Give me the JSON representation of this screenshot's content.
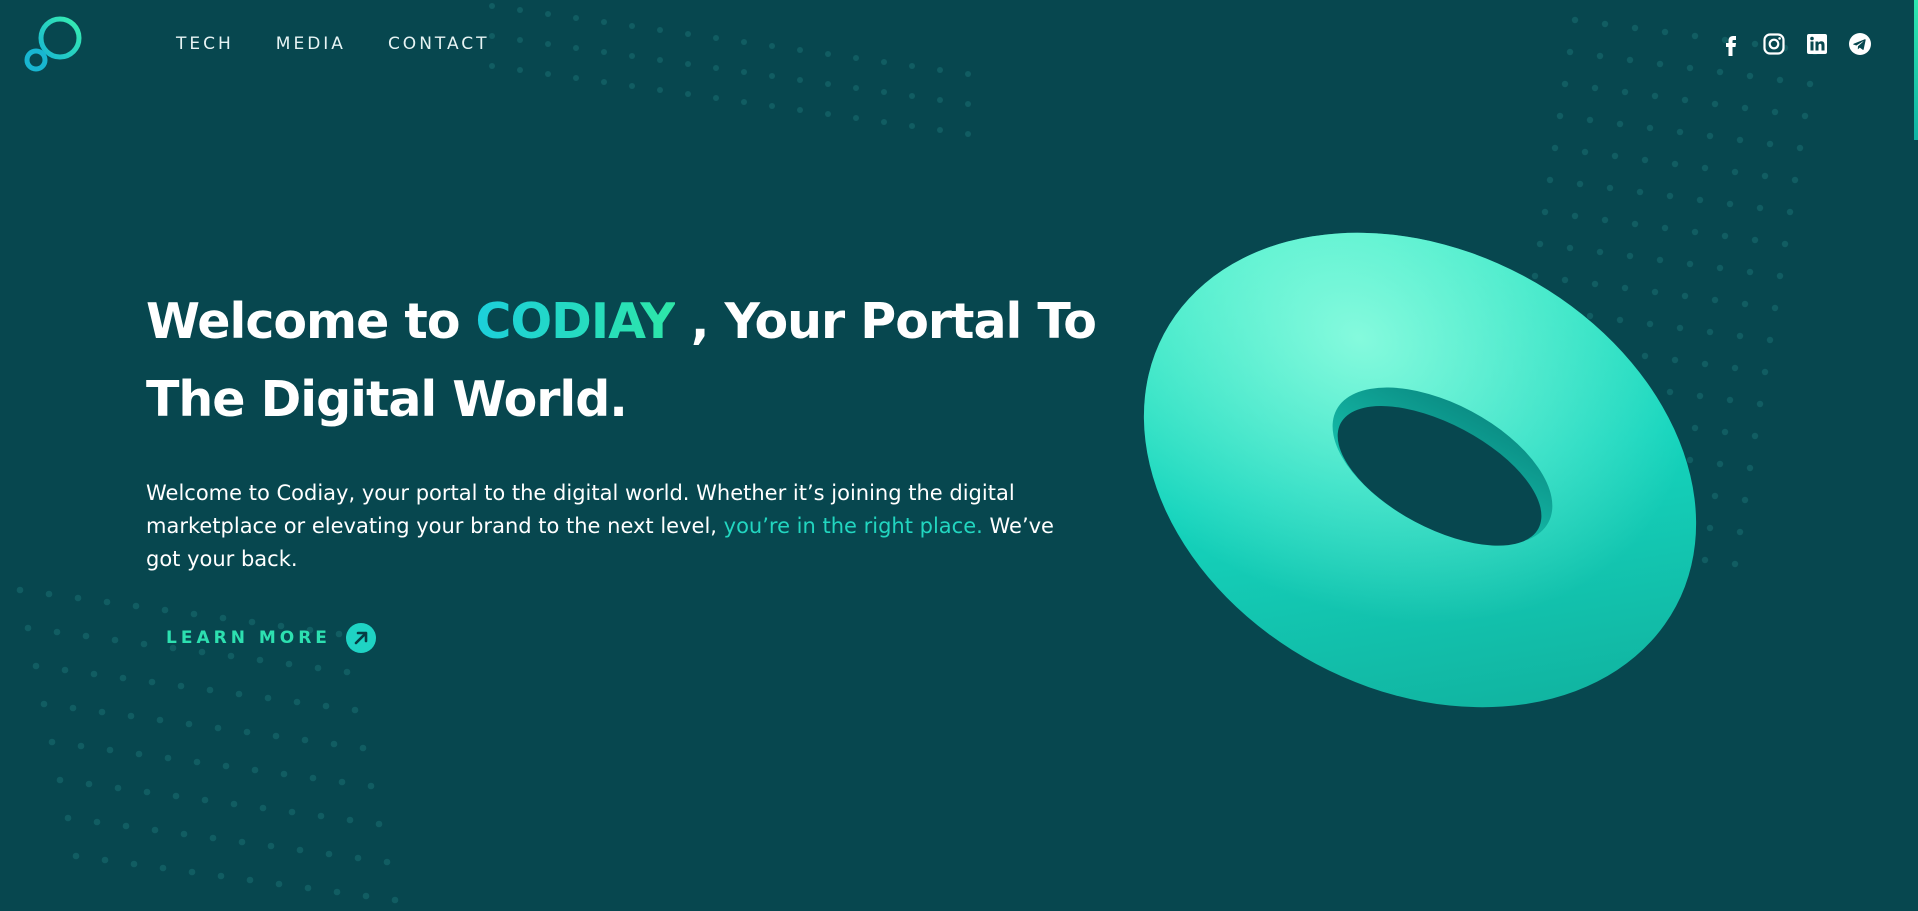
{
  "nav": {
    "items": [
      {
        "label": "TECH"
      },
      {
        "label": "MEDIA"
      },
      {
        "label": "CONTACT"
      }
    ]
  },
  "social": [
    {
      "icon": "facebook-icon"
    },
    {
      "icon": "instagram-icon"
    },
    {
      "icon": "linkedin-icon"
    },
    {
      "icon": "telegram-icon"
    }
  ],
  "hero": {
    "title_prefix": "Welcome to ",
    "title_brand": "CODIAY",
    "title_suffix": " , Your Portal To The Digital World.",
    "text_main": "Welcome to Codiay, your portal to the digital world. Whether it’s joining the digital marketplace or elevating your brand to the next level, ",
    "text_accent": "you’re in the right place.",
    "text_end": " We’ve got your back.",
    "cta_label": "LEARN MORE"
  },
  "colors": {
    "background": "#07474f",
    "accent_teal": "#1ccfdb",
    "accent_green": "#2ee6a8",
    "torus": "#19d6b8"
  }
}
